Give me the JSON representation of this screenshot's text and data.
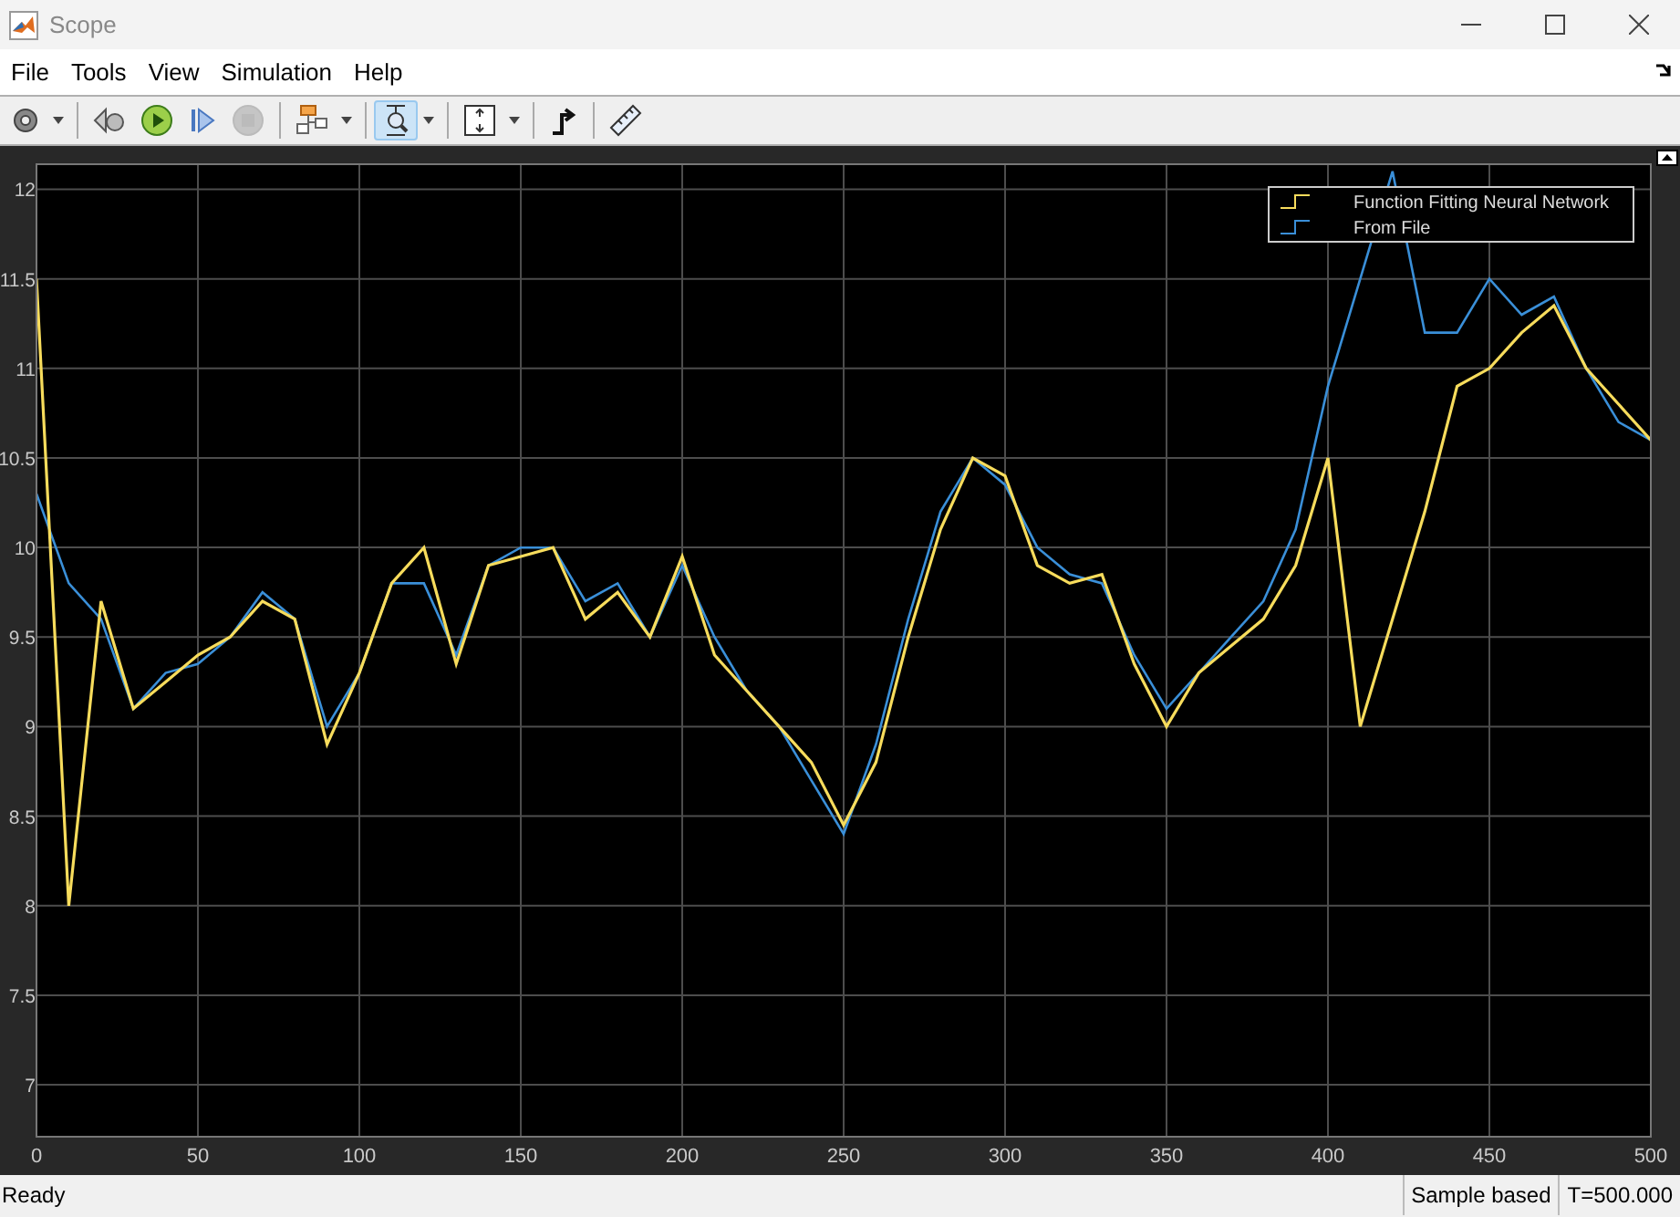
{
  "window": {
    "title": "Scope"
  },
  "menu": [
    "File",
    "Tools",
    "View",
    "Simulation",
    "Help"
  ],
  "toolbar": [
    [
      {
        "kind": "gear",
        "dropdown": true,
        "selected": false,
        "disabled": false
      }
    ],
    [
      {
        "kind": "step-back",
        "dropdown": false,
        "selected": false,
        "disabled": false
      },
      {
        "kind": "run",
        "dropdown": false,
        "selected": false,
        "disabled": false
      },
      {
        "kind": "step-forward",
        "dropdown": false,
        "selected": false,
        "disabled": false
      },
      {
        "kind": "stop",
        "dropdown": false,
        "selected": false,
        "disabled": true
      }
    ],
    [
      {
        "kind": "blocks",
        "dropdown": true,
        "selected": false,
        "disabled": false
      }
    ],
    [
      {
        "kind": "zoom",
        "dropdown": true,
        "selected": true,
        "disabled": false
      }
    ],
    [
      {
        "kind": "fit",
        "dropdown": true,
        "selected": false,
        "disabled": false
      }
    ],
    [
      {
        "kind": "trigger",
        "dropdown": false,
        "selected": false,
        "disabled": false
      }
    ],
    [
      {
        "kind": "ruler",
        "dropdown": false,
        "selected": false,
        "disabled": false
      }
    ]
  ],
  "plot": {
    "chart_data": {
      "type": "line",
      "grid": true,
      "legend": true,
      "xlim": [
        0,
        500
      ],
      "ylim": [
        6.71,
        12.14
      ],
      "xticks": [
        0,
        50,
        100,
        150,
        200,
        250,
        300,
        350,
        400,
        450,
        500
      ],
      "yticks": [
        7,
        7.5,
        8,
        8.5,
        9,
        9.5,
        10,
        10.5,
        11,
        11.5,
        12
      ],
      "x": [
        0,
        10,
        20,
        30,
        40,
        50,
        60,
        70,
        80,
        90,
        100,
        110,
        120,
        130,
        140,
        150,
        160,
        170,
        180,
        190,
        200,
        210,
        220,
        230,
        240,
        250,
        260,
        270,
        280,
        290,
        300,
        310,
        320,
        330,
        340,
        350,
        360,
        370,
        380,
        390,
        400,
        410,
        420,
        430,
        440,
        450,
        460,
        470,
        480,
        490,
        500
      ],
      "series": [
        {
          "name": "Function Fitting Neural Network",
          "color": "#f7dc5c",
          "values": [
            11.5,
            8.0,
            9.7,
            9.1,
            9.25,
            9.4,
            9.5,
            9.7,
            9.6,
            8.9,
            9.3,
            9.8,
            10.0,
            9.35,
            9.9,
            9.95,
            10.0,
            9.6,
            9.75,
            9.5,
            9.95,
            9.4,
            9.2,
            9.0,
            8.8,
            8.45,
            8.8,
            9.5,
            10.1,
            10.5,
            10.4,
            9.9,
            9.8,
            9.85,
            9.35,
            9.0,
            9.3,
            9.45,
            9.6,
            9.9,
            10.5,
            9.0,
            9.6,
            10.2,
            10.9,
            11.0,
            11.2,
            11.35,
            11.0,
            10.8,
            10.6
          ]
        },
        {
          "name": "From File",
          "color": "#3a8fd8",
          "values": [
            10.3,
            9.8,
            9.6,
            9.1,
            9.3,
            9.35,
            9.5,
            9.75,
            9.6,
            9.0,
            9.3,
            9.8,
            9.8,
            9.4,
            9.9,
            10.0,
            10.0,
            9.7,
            9.8,
            9.5,
            9.9,
            9.5,
            9.2,
            9.0,
            8.7,
            8.4,
            8.9,
            9.6,
            10.2,
            10.5,
            10.35,
            10.0,
            9.85,
            9.8,
            9.4,
            9.1,
            9.3,
            9.5,
            9.7,
            10.1,
            10.9,
            11.5,
            12.1,
            11.2,
            11.2,
            11.5,
            11.3,
            11.4,
            11.0,
            10.7,
            10.6
          ]
        }
      ]
    }
  },
  "status_bar": {
    "text": "Ready",
    "fields": [
      "Sample based",
      "T=500.000"
    ]
  }
}
